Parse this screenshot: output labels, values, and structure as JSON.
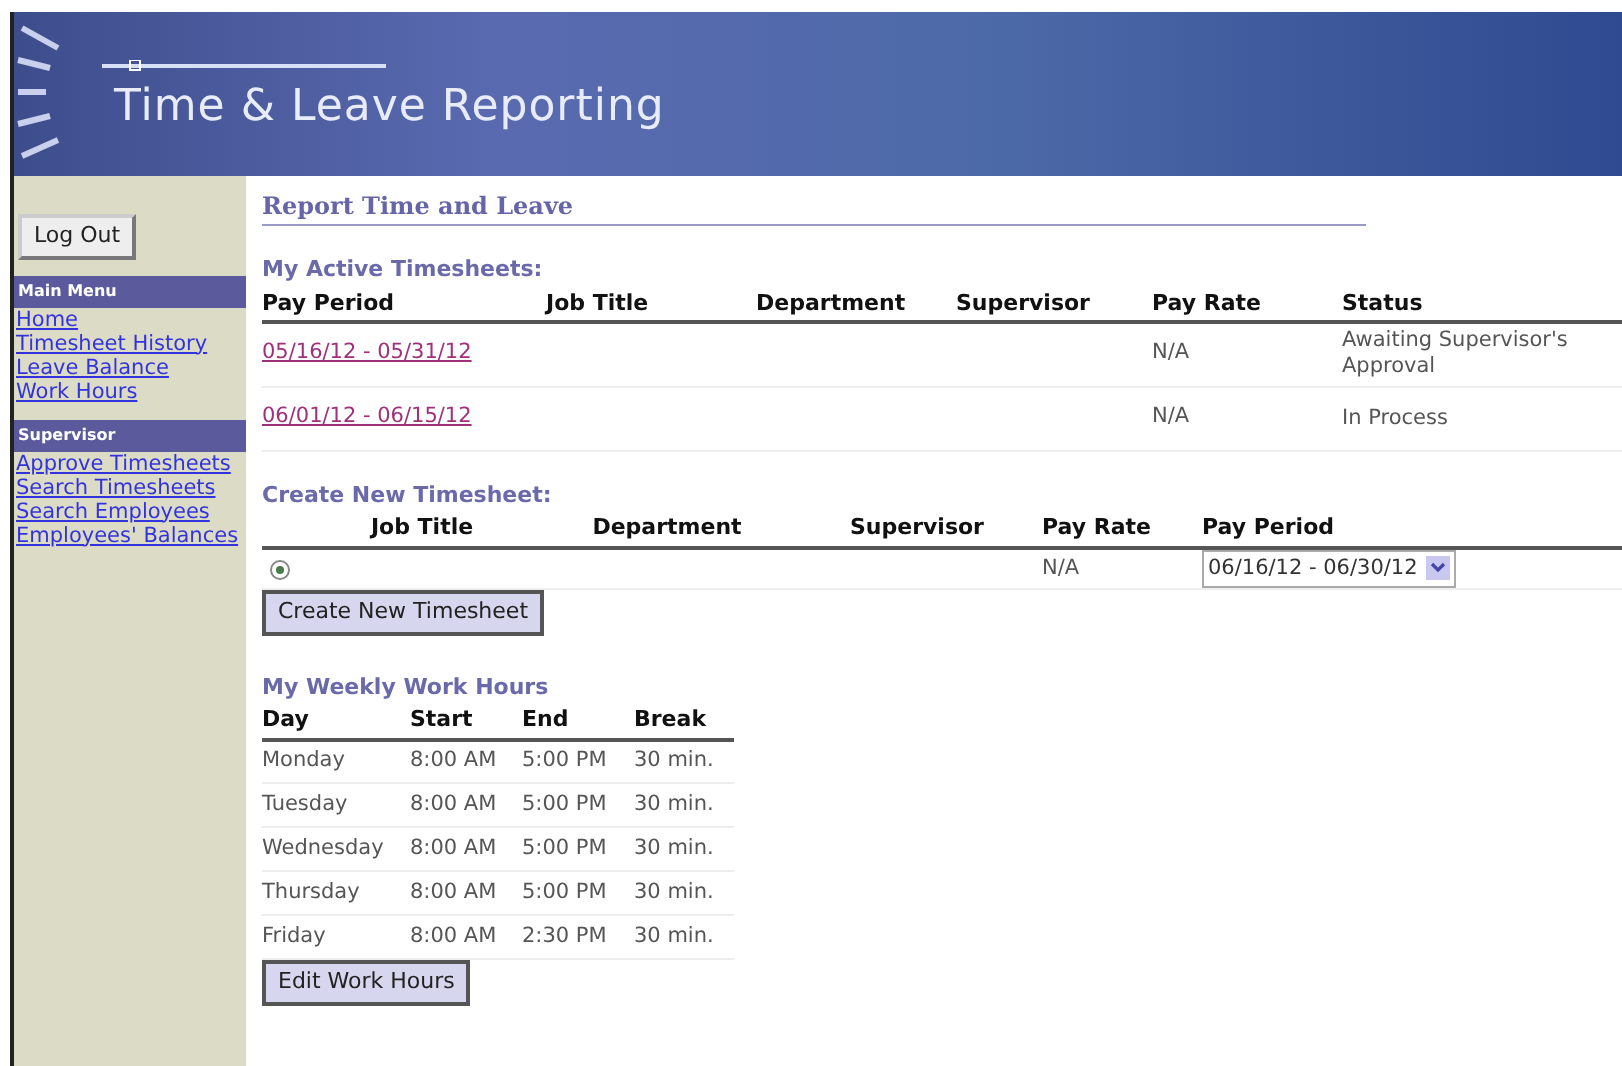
{
  "header": {
    "title": "Time & Leave Reporting"
  },
  "sidebar": {
    "logout": "Log Out",
    "sections": [
      {
        "title": "Main Menu",
        "items": [
          "Home",
          "Timesheet History",
          "Leave Balance",
          "Work Hours"
        ]
      },
      {
        "title": "Supervisor",
        "items": [
          "Approve Timesheets",
          "Search Timesheets",
          "Search Employees",
          "Employees' Balances"
        ]
      }
    ]
  },
  "page_title": "Report Time and Leave",
  "active_timesheets": {
    "title": "My Active Timesheets:",
    "columns": [
      "Pay Period",
      "Job Title",
      "Department",
      "Supervisor",
      "Pay Rate",
      "Status"
    ],
    "rows": [
      {
        "pay_period": "05/16/12 - 05/31/12",
        "pay_rate": "N/A",
        "status": "Awaiting Supervisor's Approval"
      },
      {
        "pay_period": "06/01/12 - 06/15/12",
        "pay_rate": "N/A",
        "status": "In Process"
      }
    ]
  },
  "create_timesheet": {
    "title": "Create New Timesheet:",
    "columns": [
      "Job Title",
      "Department",
      "Supervisor",
      "Pay Rate",
      "Pay Period"
    ],
    "rows": [
      {
        "selected": true,
        "pay_rate": "N/A",
        "pay_period": "06/16/12 - 06/30/12"
      }
    ],
    "button": "Create New Timesheet"
  },
  "work_hours": {
    "title": "My Weekly Work Hours",
    "columns": [
      "Day",
      "Start",
      "End",
      "Break"
    ],
    "rows": [
      [
        "Monday",
        "8:00 AM",
        "5:00 PM",
        "30 min."
      ],
      [
        "Tuesday",
        "8:00 AM",
        "5:00 PM",
        "30 min."
      ],
      [
        "Wednesday",
        "8:00 AM",
        "5:00 PM",
        "30 min."
      ],
      [
        "Thursday",
        "8:00 AM",
        "5:00 PM",
        "30 min."
      ],
      [
        "Friday",
        "8:00 AM",
        "2:30 PM",
        "30 min."
      ]
    ],
    "button": "Edit Work Hours"
  }
}
